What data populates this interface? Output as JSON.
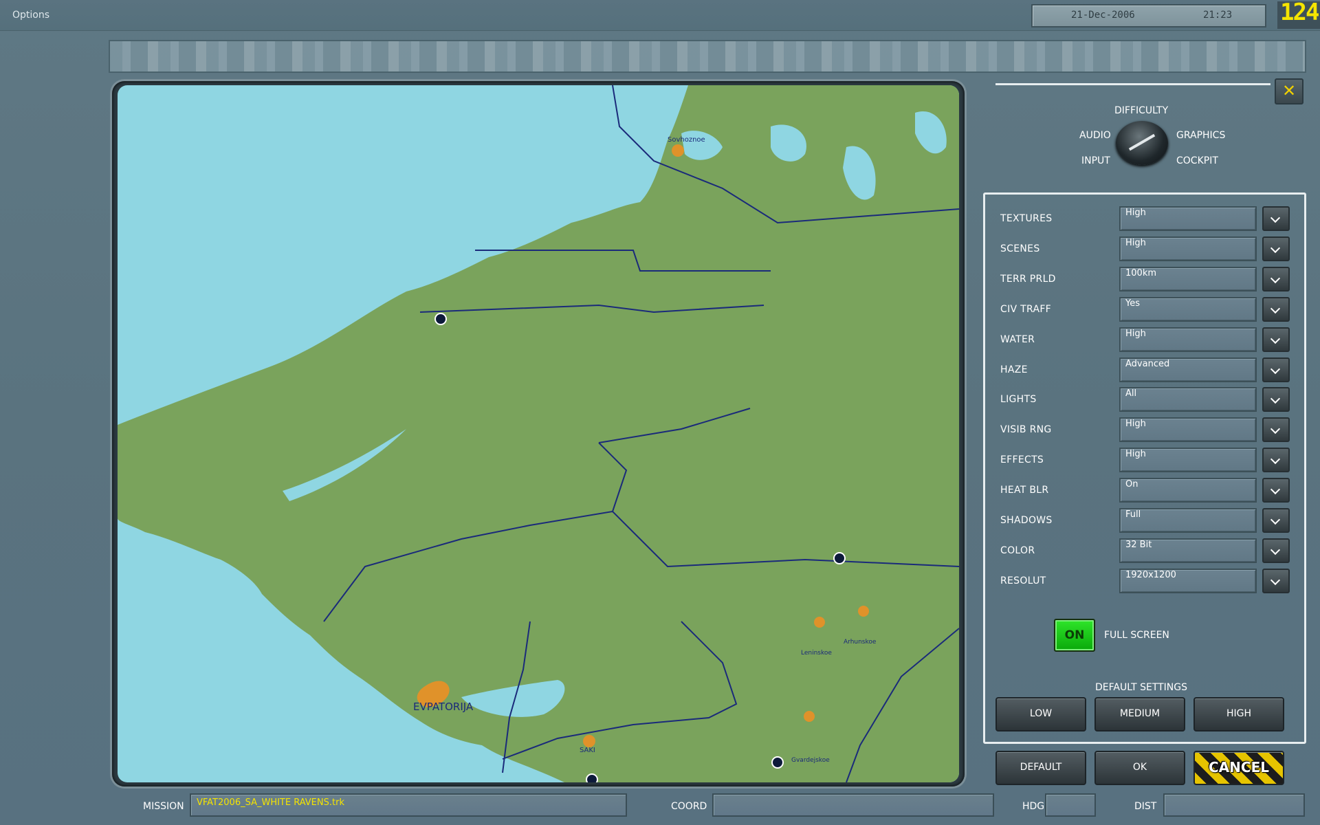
{
  "window": {
    "title": "Options",
    "date": "21-Dec-2006",
    "time": "21:23",
    "counter": "124"
  },
  "knob": {
    "labels": {
      "difficulty": "DIFFICULTY",
      "audio": "AUDIO",
      "graphics": "GRAPHICS",
      "input": "INPUT",
      "cockpit": "COCKPIT"
    },
    "selected": "GRAPHICS"
  },
  "settings": [
    {
      "label": "TEXTURES",
      "value": "High"
    },
    {
      "label": "SCENES",
      "value": "High"
    },
    {
      "label": "TERR PRLD",
      "value": "100km"
    },
    {
      "label": "CIV TRAFF",
      "value": "Yes"
    },
    {
      "label": "WATER",
      "value": "High"
    },
    {
      "label": "HAZE",
      "value": "Advanced"
    },
    {
      "label": "LIGHTS",
      "value": "All"
    },
    {
      "label": "VISIB RNG",
      "value": "High"
    },
    {
      "label": "EFFECTS",
      "value": "High"
    },
    {
      "label": "HEAT BLR",
      "value": "On"
    },
    {
      "label": "SHADOWS",
      "value": "Full"
    },
    {
      "label": "COLOR",
      "value": "32 Bit"
    },
    {
      "label": "RESOLUT",
      "value": "1920x1200"
    }
  ],
  "fullscreen": {
    "state": "ON",
    "label": "FULL SCREEN"
  },
  "default_settings": {
    "title": "DEFAULT SETTINGS",
    "low": "LOW",
    "medium": "MEDIUM",
    "high": "HIGH"
  },
  "actions": {
    "default": "DEFAULT",
    "ok": "OK",
    "cancel": "CANCEL"
  },
  "bottom": {
    "mission_label": "MISSION",
    "mission_value": "VFAT2006_SA_WHITE RAVENS.trk",
    "coord_label": "COORD",
    "coord_value": "",
    "hdg_label": "HDG",
    "hdg_value": "",
    "dist_label": "DIST",
    "dist_value": ""
  },
  "map": {
    "towns": [
      "Sovhoznoe",
      "EVPATORIJA",
      "SAKI",
      "Leninskoe",
      "Arhunskoe",
      "Gvardejskoe"
    ],
    "colors": {
      "water": "#8fd6e2",
      "land": "#7aa35c",
      "roads": "#1a2a7a",
      "towns": "#e0922a"
    }
  },
  "colors": {
    "panel_bg": "#5a737f",
    "accent_yellow": "#f5e400",
    "toggle_green": "#1ed01a"
  }
}
